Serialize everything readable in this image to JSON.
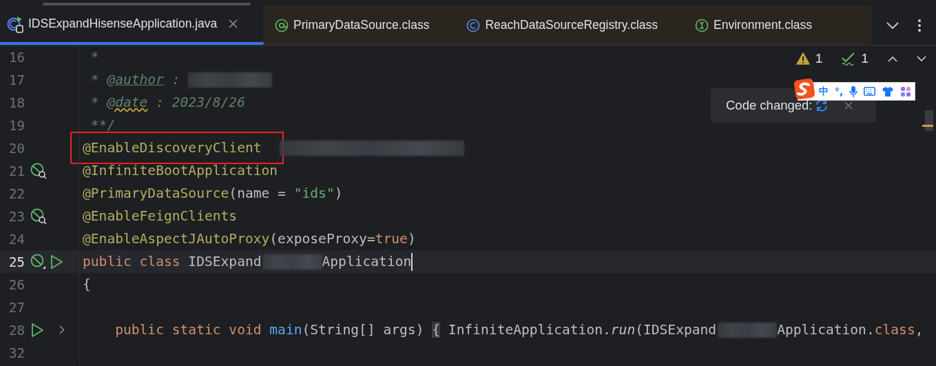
{
  "tabs": [
    {
      "label": "IDSExpandHisenseApplication.java",
      "kind": "class-run",
      "selected": true,
      "closable": true
    },
    {
      "label": "PrimaryDataSource.class",
      "kind": "annotation",
      "selected": false,
      "closable": false
    },
    {
      "label": "ReachDataSourceRegistry.class",
      "kind": "class",
      "selected": false,
      "closable": false
    },
    {
      "label": "Environment.class",
      "kind": "interface",
      "selected": false,
      "closable": false
    }
  ],
  "inspections": {
    "warnings": "1",
    "passed": "1"
  },
  "notification": {
    "text": "Code changed:"
  },
  "ime_toolbar": {
    "mode": "中",
    "punctuation": "°,"
  },
  "lines": [
    {
      "number": "16",
      "current": false,
      "tokens": [
        {
          "kind": "comment",
          "text": " *"
        }
      ]
    },
    {
      "number": "17",
      "current": false,
      "tokens": [
        {
          "kind": "comment",
          "text": " * "
        },
        {
          "kind": "doc-tag",
          "text": "@author"
        },
        {
          "kind": "comment",
          "text": " : "
        },
        {
          "kind": "redacted-medium"
        }
      ]
    },
    {
      "number": "18",
      "current": false,
      "tokens": [
        {
          "kind": "comment",
          "text": " * "
        },
        {
          "kind": "doc-tag-warn",
          "text": "@date"
        },
        {
          "kind": "comment",
          "text": " : 2023/8/26"
        }
      ]
    },
    {
      "number": "19",
      "current": false,
      "tokens": [
        {
          "kind": "comment",
          "text": " **/"
        }
      ]
    },
    {
      "number": "20",
      "current": false,
      "tokens": [
        {
          "kind": "framed",
          "text": "@EnableDiscoveryClient"
        },
        {
          "kind": "redacted-long"
        }
      ]
    },
    {
      "number": "21",
      "current": false,
      "markers": [
        {
          "kind": "bean-search"
        }
      ],
      "tokens": [
        {
          "kind": "annotation",
          "text": "@InfiniteBootApplication"
        }
      ]
    },
    {
      "number": "22",
      "current": false,
      "tokens": [
        {
          "kind": "annotation",
          "text": "@PrimaryDataSource"
        },
        {
          "kind": "plain",
          "text": "(name = "
        },
        {
          "kind": "string",
          "text": "\"ids\""
        },
        {
          "kind": "plain",
          "text": ")"
        }
      ]
    },
    {
      "number": "23",
      "current": false,
      "markers": [
        {
          "kind": "bean-search"
        }
      ],
      "tokens": [
        {
          "kind": "annotation",
          "text": "@EnableFeignClients"
        }
      ]
    },
    {
      "number": "24",
      "current": false,
      "tokens": [
        {
          "kind": "annotation",
          "text": "@EnableAspectJAutoProxy"
        },
        {
          "kind": "plain",
          "text": "(exposeProxy="
        },
        {
          "kind": "keyword",
          "text": "true"
        },
        {
          "kind": "plain",
          "text": ")"
        }
      ]
    },
    {
      "number": "25",
      "current": true,
      "markers": [
        {
          "kind": "bean-disabled"
        },
        {
          "kind": "run"
        }
      ],
      "tokens": [
        {
          "kind": "keyword",
          "text": "public class "
        },
        {
          "kind": "plain",
          "text": "IDSExpand"
        },
        {
          "kind": "redacted-short"
        },
        {
          "kind": "plain",
          "text": "Application"
        },
        {
          "kind": "caret"
        }
      ]
    },
    {
      "number": "26",
      "current": false,
      "tokens": [
        {
          "kind": "plain",
          "text": "{"
        }
      ]
    },
    {
      "number": "27",
      "current": false
    },
    {
      "number": "28",
      "current": false,
      "markers": [
        {
          "kind": "run"
        },
        {
          "kind": "fold"
        }
      ],
      "tokens": [
        {
          "kind": "keyword",
          "text": "    public static void "
        },
        {
          "kind": "function",
          "text": "main"
        },
        {
          "kind": "plain",
          "text": "(String[] args) "
        },
        {
          "kind": "brace",
          "text": "{"
        },
        {
          "kind": "plain",
          "text": " InfiniteApplication."
        },
        {
          "kind": "static-call",
          "text": "run"
        },
        {
          "kind": "plain",
          "text": "(IDSExpand"
        },
        {
          "kind": "redacted-short"
        },
        {
          "kind": "plain",
          "text": "Application."
        },
        {
          "kind": "keyword",
          "text": "class"
        },
        {
          "kind": "plain",
          "text": ","
        }
      ]
    },
    {
      "number": "32",
      "current": false
    }
  ]
}
